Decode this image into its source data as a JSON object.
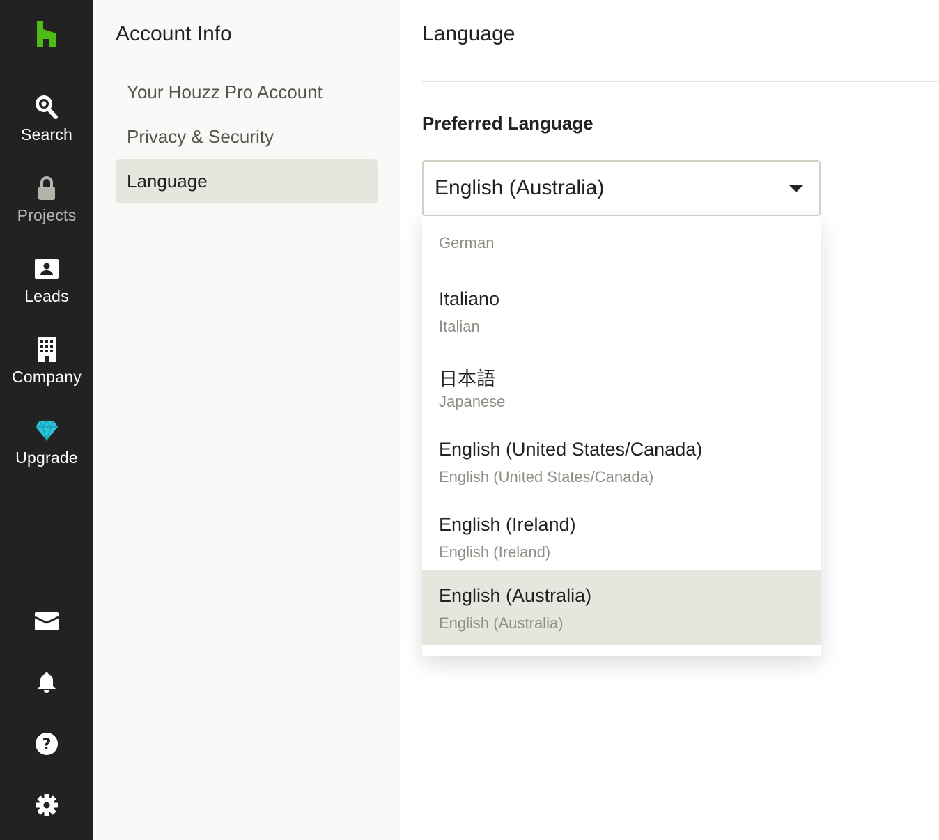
{
  "rail": {
    "items": [
      {
        "label": "Search",
        "icon": "search-icon"
      },
      {
        "label": "Projects",
        "icon": "lock-icon"
      },
      {
        "label": "Leads",
        "icon": "contact-card-icon"
      },
      {
        "label": "Company",
        "icon": "building-icon"
      },
      {
        "label": "Upgrade",
        "icon": "diamond-icon"
      }
    ],
    "bottom_icons": [
      "inbox-icon",
      "bell-icon",
      "help-icon",
      "gear-icon"
    ],
    "logo_color": "#4dbc15",
    "upgrade_color": "#2bc4dc"
  },
  "subnav": {
    "title": "Account Info",
    "items": [
      {
        "label": "Your Houzz Pro Account"
      },
      {
        "label": "Privacy & Security"
      },
      {
        "label": "Language"
      }
    ]
  },
  "main": {
    "title": "Language",
    "field_label": "Preferred Language",
    "select": {
      "value": "English (Australia)"
    },
    "options": [
      {
        "native": "",
        "english": "German"
      },
      {
        "native": "Italiano",
        "english": "Italian"
      },
      {
        "native": "日本語",
        "english": "Japanese"
      },
      {
        "native": "English (United States/Canada)",
        "english": "English (United States/Canada)"
      },
      {
        "native": "English (Ireland)",
        "english": "English (Ireland)"
      },
      {
        "native": "English (Australia)",
        "english": "English (Australia)"
      }
    ]
  }
}
